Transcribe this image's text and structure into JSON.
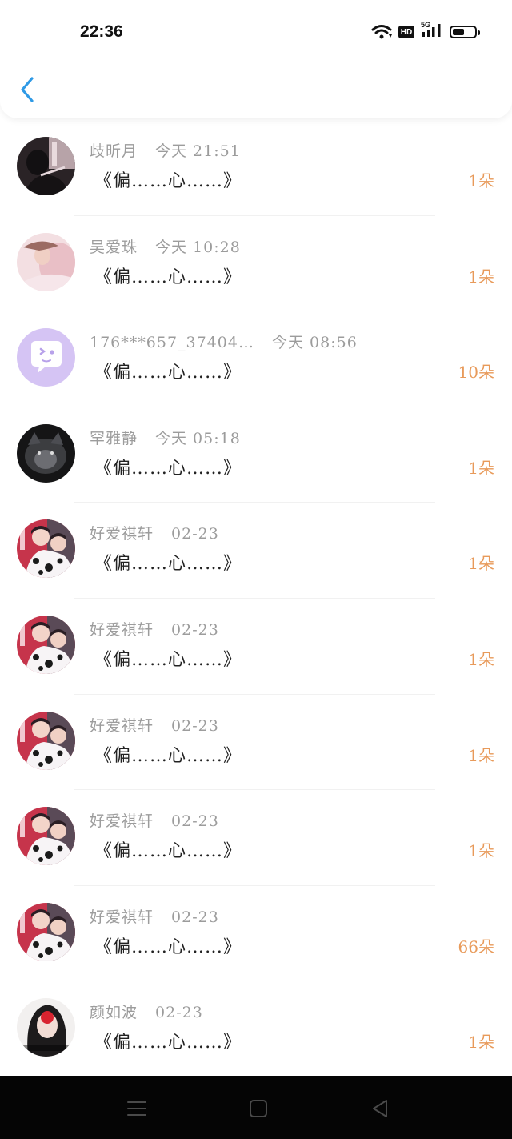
{
  "status_bar": {
    "time": "22:36",
    "hd": "HD",
    "network": "5G",
    "battery_level": 0.55
  },
  "header": {
    "back_icon": "chevron-left-icon"
  },
  "colors": {
    "accent": "#2f9ae6",
    "count": "#e89a5a",
    "name": "#9c9c9c",
    "message": "#222222"
  },
  "items": [
    {
      "name": "歧昕月",
      "time": "今天 21:51",
      "message": "《偏……心……》",
      "count": "1朵",
      "avatar": "avatar-dark-photo"
    },
    {
      "name": "吴爱珠",
      "time": "今天 10:28",
      "message": "《偏……心……》",
      "count": "1朵",
      "avatar": "avatar-pink-photo"
    },
    {
      "name": "176***657_37404…",
      "time": "今天 08:56",
      "message": "《偏……心……》",
      "count": "10朵",
      "avatar": "default-chat-icon"
    },
    {
      "name": "罕雅静",
      "time": "今天 05:18",
      "message": "《偏……心……》",
      "count": "1朵",
      "avatar": "avatar-wolf-photo"
    },
    {
      "name": "好爱祺轩",
      "time": "02-23",
      "message": "《偏……心……》",
      "count": "1朵",
      "avatar": "avatar-couple-photo"
    },
    {
      "name": "好爱祺轩",
      "time": "02-23",
      "message": "《偏……心……》",
      "count": "1朵",
      "avatar": "avatar-couple-photo"
    },
    {
      "name": "好爱祺轩",
      "time": "02-23",
      "message": "《偏……心……》",
      "count": "1朵",
      "avatar": "avatar-couple-photo"
    },
    {
      "name": "好爱祺轩",
      "time": "02-23",
      "message": "《偏……心……》",
      "count": "1朵",
      "avatar": "avatar-couple-photo"
    },
    {
      "name": "好爱祺轩",
      "time": "02-23",
      "message": "《偏……心……》",
      "count": "66朵",
      "avatar": "avatar-couple-photo"
    },
    {
      "name": "颜如波",
      "time": "02-23",
      "message": "《偏……心……》",
      "count": "1朵",
      "avatar": "avatar-girl-photo"
    }
  ],
  "nav": {
    "menu_icon": "menu-icon",
    "home_icon": "home-square-icon",
    "back_icon": "back-triangle-icon"
  }
}
